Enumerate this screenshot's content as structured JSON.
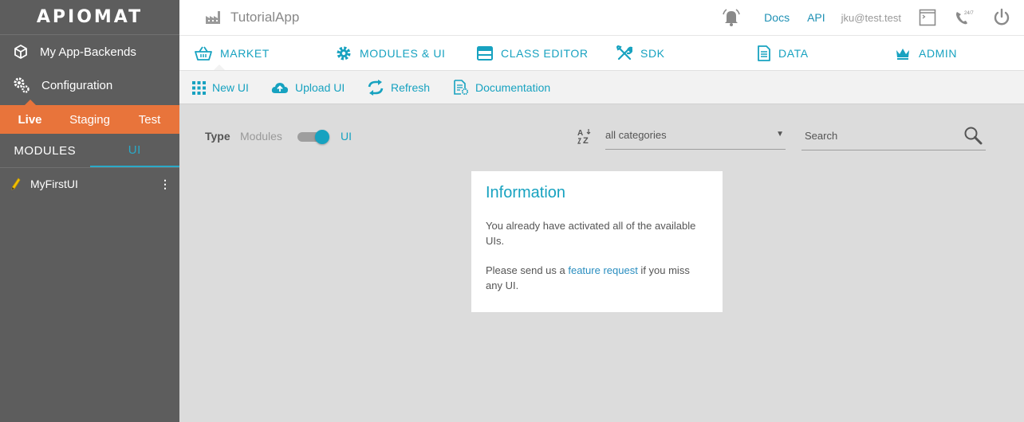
{
  "sidebar": {
    "logo": "APIOMAT",
    "nav": [
      {
        "label": "My App-Backends",
        "icon": "cube-icon"
      },
      {
        "label": "Configuration",
        "icon": "gears-icon"
      }
    ],
    "env_tabs": [
      "Live",
      "Staging",
      "Test"
    ],
    "active_env": "Live",
    "sub_tabs": [
      "MODULES",
      "UI"
    ],
    "active_sub_tab": "UI",
    "items": [
      {
        "label": "MyFirstUI",
        "icon": "pencil-icon"
      }
    ]
  },
  "topbar": {
    "app_name": "TutorialApp",
    "docs_label": "Docs",
    "api_label": "API",
    "user": "jku@test.test",
    "support_badge": "24/7"
  },
  "main_nav": [
    {
      "label": "MARKET",
      "icon": "basket-icon",
      "active": true
    },
    {
      "label": "MODULES & UI",
      "icon": "gear-icon"
    },
    {
      "label": "CLASS EDITOR",
      "icon": "window-icon"
    },
    {
      "label": "SDK",
      "icon": "tools-icon"
    },
    {
      "label": "DATA",
      "icon": "document-icon"
    },
    {
      "label": "ADMIN",
      "icon": "crown-icon"
    }
  ],
  "toolbar": [
    {
      "label": "New UI",
      "icon": "grid-icon"
    },
    {
      "label": "Upload UI",
      "icon": "cloud-upload-icon"
    },
    {
      "label": "Refresh",
      "icon": "refresh-icon"
    },
    {
      "label": "Documentation",
      "icon": "documentation-icon"
    }
  ],
  "filter": {
    "type_label": "Type",
    "type_off": "Modules",
    "type_on": "UI",
    "toggle_on": true,
    "category": "all categories",
    "search_placeholder": "Search"
  },
  "info": {
    "title": "Information",
    "text1": "You already have activated all of the available UIs.",
    "text2_before": "Please send us a ",
    "text2_link": "feature request",
    "text2_after": " if you miss any UI."
  },
  "colors": {
    "sidebar": "#5d5d5d",
    "accent": "#17a2c0",
    "env_bar": "#e8743b",
    "content_bg": "#dcdcdc"
  }
}
